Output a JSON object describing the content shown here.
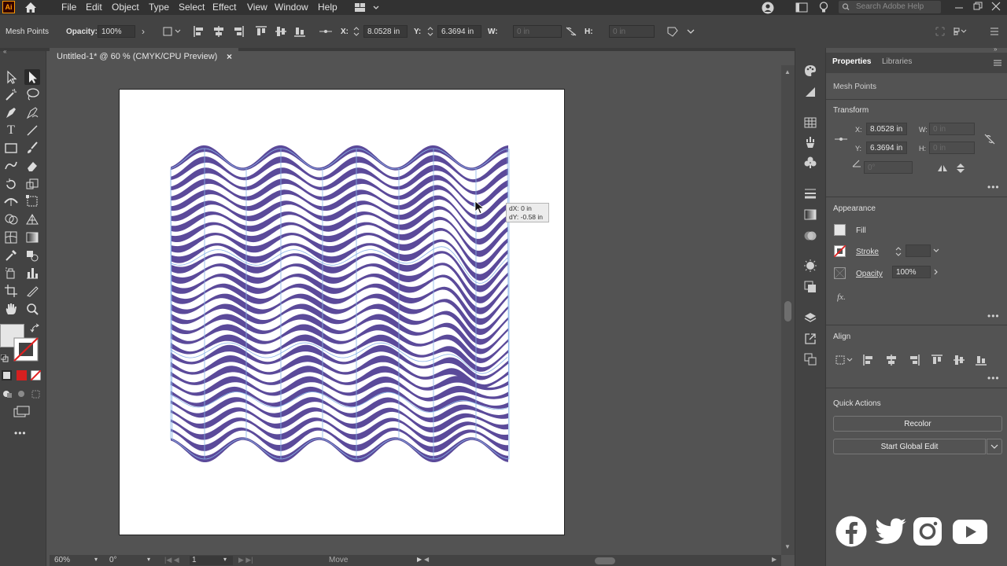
{
  "app": {
    "logo": "Ai"
  },
  "menu": [
    "File",
    "Edit",
    "Object",
    "Type",
    "Select",
    "Effect",
    "View",
    "Window",
    "Help"
  ],
  "search": {
    "placeholder": "Search Adobe Help"
  },
  "control_bar": {
    "mode": "Mesh Points",
    "opacity_label": "Opacity:",
    "opacity_value": "100%",
    "x_label": "X:",
    "x_value": "8.0528 in",
    "y_label": "Y:",
    "y_value": "6.3694 in",
    "w_label": "W:",
    "w_value": "0 in",
    "h_label": "H:",
    "h_value": "0 in"
  },
  "document": {
    "tab_title": "Untitled-1* @ 60 % (CMYK/CPU Preview)",
    "tooltip_dx": "dX: 0 in",
    "tooltip_dy": "dY: -0.58 in",
    "colors": {
      "stripe": "#5b4a9a",
      "mesh": "#8ab4e8",
      "artboard": "#ffffff"
    }
  },
  "status_bar": {
    "zoom": "60%",
    "rotation": "0°",
    "artboard": "1",
    "mode": "Move"
  },
  "panel": {
    "tabs": [
      "Properties",
      "Libraries"
    ],
    "selection": "Mesh Points",
    "transform": {
      "title": "Transform",
      "x_label": "X:",
      "x_value": "8.0528 in",
      "y_label": "Y:",
      "y_value": "6.3694 in",
      "w_label": "W:",
      "w_value": "0 in",
      "h_label": "H:",
      "h_value": "0 in",
      "angle_value": "0°"
    },
    "appearance": {
      "title": "Appearance",
      "fill": "Fill",
      "stroke": "Stroke",
      "opacity": "Opacity",
      "opacity_value": "100%",
      "fx": "fx."
    },
    "align": {
      "title": "Align"
    },
    "quick_actions": {
      "title": "Quick Actions",
      "recolor": "Recolor",
      "global_edit": "Start Global Edit"
    }
  },
  "social_icons": [
    "facebook-icon",
    "twitter-icon",
    "instagram-icon",
    "youtube-icon"
  ]
}
